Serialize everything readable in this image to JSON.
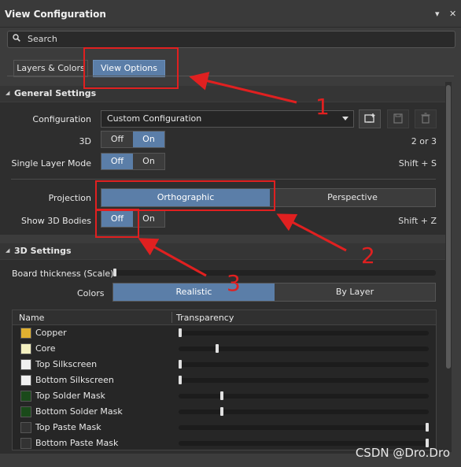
{
  "window": {
    "title": "View Configuration",
    "controls": [
      "▾",
      "✕"
    ]
  },
  "search": {
    "placeholder": "Search"
  },
  "tabs": [
    {
      "label": "Layers & Colors",
      "active": false
    },
    {
      "label": "View Options",
      "active": true
    }
  ],
  "general": {
    "header": "General Settings",
    "configuration_label": "Configuration",
    "configuration_value": "Custom Configuration",
    "rows": [
      {
        "label": "3D",
        "off": "Off",
        "on": "On",
        "selected": "On",
        "shortcut": "2 or 3"
      },
      {
        "label": "Single Layer Mode",
        "off": "Off",
        "on": "On",
        "selected": "Off",
        "shortcut": "Shift + S"
      }
    ],
    "projection_label": "Projection",
    "projection_options": [
      "Orthographic",
      "Perspective"
    ],
    "projection_selected": "Orthographic",
    "show3d_label": "Show 3D Bodies",
    "show3d_off": "Off",
    "show3d_on": "On",
    "show3d_selected": "Off",
    "show3d_shortcut": "Shift + Z"
  },
  "settings3d": {
    "header": "3D Settings",
    "board_thickness_label": "Board thickness (Scale)",
    "board_thickness_value": 0,
    "colors_label": "Colors",
    "colors_options": [
      "Realistic",
      "By Layer"
    ],
    "colors_selected": "Realistic",
    "table": {
      "columns": [
        "Name",
        "Transparency"
      ],
      "rows": [
        {
          "name": "Copper",
          "color": "#e0b030",
          "transparency": 0.0
        },
        {
          "name": "Core",
          "color": "#f4f0c0",
          "transparency": 0.15
        },
        {
          "name": "Top Silkscreen",
          "color": "#f0f0f0",
          "transparency": 0.0
        },
        {
          "name": "Bottom Silkscreen",
          "color": "#f0f0f0",
          "transparency": 0.0
        },
        {
          "name": "Top Solder Mask",
          "color": "#1a4a1a",
          "transparency": 0.17
        },
        {
          "name": "Bottom Solder Mask",
          "color": "#1a4a1a",
          "transparency": 0.17
        },
        {
          "name": "Top Paste Mask",
          "color": "#333333",
          "transparency": 1.0
        },
        {
          "name": "Bottom Paste Mask",
          "color": "#333333",
          "transparency": 1.0
        }
      ]
    }
  },
  "annotations": {
    "labels": [
      "1",
      "2",
      "3"
    ],
    "color": "#e02020"
  },
  "watermark": "CSDN @Dro.Dro"
}
